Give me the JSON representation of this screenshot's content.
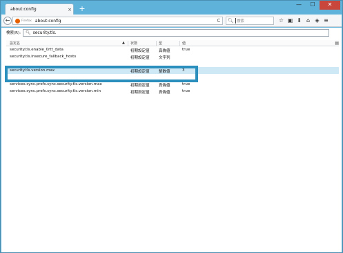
{
  "window": {
    "tab_title": "about:config",
    "tab_close": "×",
    "new_tab": "+",
    "controls": {
      "minimize": "—",
      "maximize": "☐",
      "close": "✕"
    }
  },
  "navbar": {
    "back": "←",
    "identity": "Firefox",
    "url": "about:config",
    "reload": "C",
    "search_placeholder": "検索",
    "search_icon": "search-icon",
    "toolbar_icons": [
      "star-icon",
      "clipboard-icon",
      "download-icon",
      "home-icon",
      "pocket-icon",
      "menu-icon"
    ]
  },
  "filter": {
    "label": "検索(R):",
    "value": "security.tls."
  },
  "table": {
    "headers": {
      "name": "設定名",
      "status": "状態",
      "type": "型",
      "value": "値"
    },
    "sort_indicator": "▲",
    "rows": [
      {
        "name": "security.tls.enable_0rtt_data",
        "status": "初期設定値",
        "type": "真偽値",
        "value": "true",
        "selected": false
      },
      {
        "name": "security.tls.insecure_fallback_hosts",
        "status": "初期設定値",
        "type": "文字列",
        "value": "",
        "selected": false
      },
      {
        "name": "",
        "status": "",
        "type": "",
        "value": "",
        "selected": false
      },
      {
        "name": "security.tls.version.max",
        "status": "初期設定値",
        "type": "整数値",
        "value": "3",
        "selected": true
      },
      {
        "name": "",
        "status": "",
        "type": "",
        "value": "",
        "selected": false
      },
      {
        "name": "services.sync.prefs.sync.security.tls.version.max",
        "status": "初期設定値",
        "type": "真偽値",
        "value": "true",
        "selected": false
      },
      {
        "name": "services.sync.prefs.sync.security.tls.version.min",
        "status": "初期設定値",
        "type": "真偽値",
        "value": "true",
        "selected": false
      }
    ]
  },
  "colors": {
    "frame": "#5fb3da",
    "selected_row": "#cfe8f6",
    "highlight": "#2b8fbd"
  }
}
